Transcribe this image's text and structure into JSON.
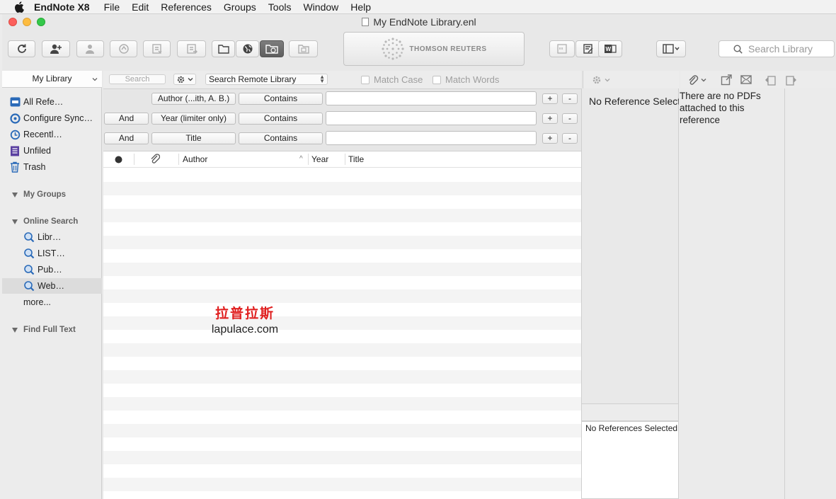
{
  "menubar": {
    "app_name": "EndNote X8",
    "menus": [
      "File",
      "Edit",
      "References",
      "Groups",
      "Tools",
      "Window",
      "Help"
    ]
  },
  "window": {
    "title": "My EndNote Library.enl"
  },
  "toolbar": {
    "logo_text": "THOMSON REUTERS",
    "search_placeholder": "Search Library",
    "icons": [
      "sync-icon",
      "add-user-icon",
      "share-icon",
      "find-full-text-icon",
      "import-icon",
      "export-icon",
      "local-library-icon",
      "online-search-icon",
      "integrated-library-icon",
      "copy-to-library-icon",
      "cite-icon",
      "edit-icon",
      "word-icon",
      "layout-icon"
    ]
  },
  "sidebar": {
    "library_select": "My Library",
    "items": [
      {
        "label": "All Refe…",
        "icon": "all-references-icon"
      },
      {
        "label": "Configure Sync…",
        "icon": "sync-icon"
      },
      {
        "label": "Recentl…",
        "icon": "recent-icon"
      },
      {
        "label": "Unfiled",
        "icon": "unfiled-icon"
      },
      {
        "label": "Trash",
        "icon": "trash-icon"
      }
    ],
    "groups": {
      "my_groups": "My Groups",
      "online_search": "Online Search",
      "find_full_text": "Find Full Text"
    },
    "online_items": [
      {
        "label": "Libr…",
        "selected": false
      },
      {
        "label": "LIST…",
        "selected": false
      },
      {
        "label": "Pub…",
        "selected": false
      },
      {
        "label": "Web…",
        "selected": true
      }
    ],
    "more_label": "more..."
  },
  "search_panel": {
    "mini_search_placeholder": "Search",
    "remote_select": "Search Remote Library",
    "match_case": "Match Case",
    "match_words": "Match Words",
    "rows": [
      {
        "bool": "",
        "field": "Author (...ith, A. B.)",
        "operator": "Contains",
        "value": ""
      },
      {
        "bool": "And",
        "field": "Year (limiter only)",
        "operator": "Contains",
        "value": ""
      },
      {
        "bool": "And",
        "field": "Title",
        "operator": "Contains",
        "value": ""
      }
    ],
    "plus_label": "+",
    "minus_label": "-"
  },
  "reference_list": {
    "columns": [
      "Author",
      "Year",
      "Title"
    ],
    "sort_indicator": "^"
  },
  "watermark": {
    "chinese": "拉普拉斯",
    "url": "lapulace.com"
  },
  "preview": {
    "no_reference": "No Reference Selected",
    "no_references": "No References Selected"
  },
  "pdf_pane": {
    "message": "There are no PDFs attached to this reference"
  },
  "colors": {
    "traffic_red": "#fc605c",
    "traffic_yellow": "#fdbc40",
    "traffic_green": "#34c84a",
    "selection_gray": "#dcdcdc",
    "icon_blue": "#2a6ab8",
    "watermark_red": "#e02020"
  }
}
